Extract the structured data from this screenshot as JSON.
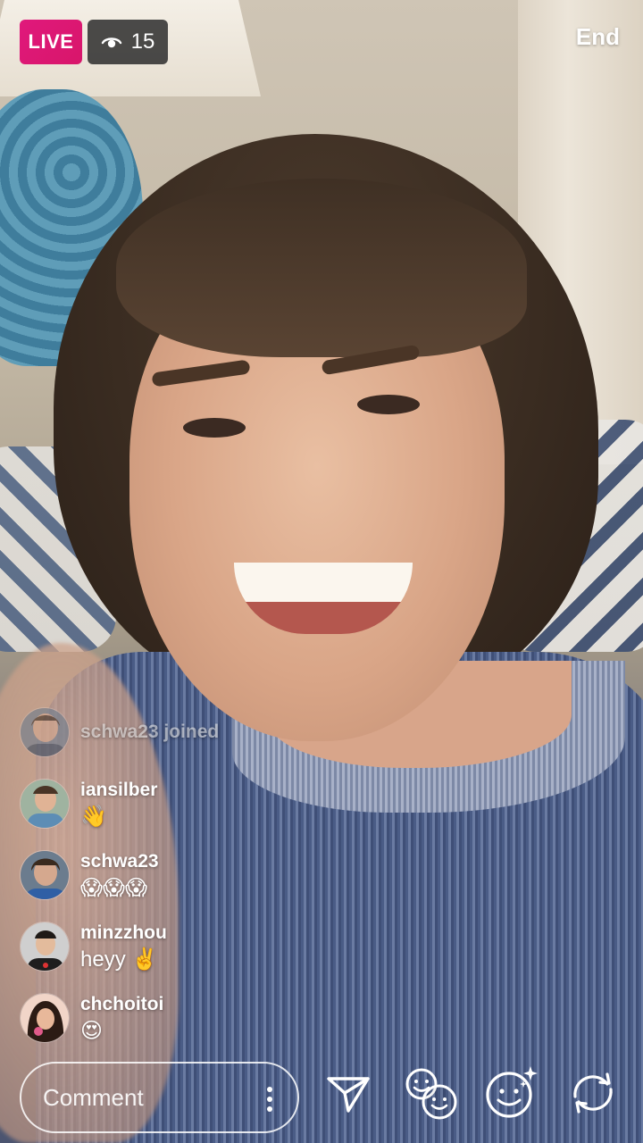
{
  "header": {
    "live_label": "LIVE",
    "viewer_count": "15",
    "end_label": "End",
    "icons": {
      "viewers": "eye-icon"
    }
  },
  "comments": [
    {
      "user": "schwa23",
      "message": "joined",
      "type": "join",
      "avatar": "avatar-schwa23"
    },
    {
      "user": "iansilber",
      "message": "👋",
      "type": "comment",
      "avatar": "avatar-iansilber"
    },
    {
      "user": "schwa23",
      "message": "😱😱😱",
      "type": "comment",
      "avatar": "avatar-schwa23"
    },
    {
      "user": "minzzhou",
      "message": "heyy ✌️",
      "type": "comment",
      "avatar": "avatar-minzzhou"
    },
    {
      "user": "chchoitoi",
      "message": "😍",
      "type": "comment",
      "avatar": "avatar-chchoitoi"
    }
  ],
  "joined_text": "schwa23 joined",
  "composer": {
    "placeholder": "Comment",
    "icons": {
      "more": "more-vertical-icon",
      "send": "send-icon",
      "guest": "add-guest-icon",
      "effects": "face-filters-icon",
      "flip": "flip-camera-icon"
    }
  },
  "colors": {
    "live_badge": "#d8166a",
    "viewer_badge_bg": "#2d2d2d",
    "text": "#ffffff"
  }
}
